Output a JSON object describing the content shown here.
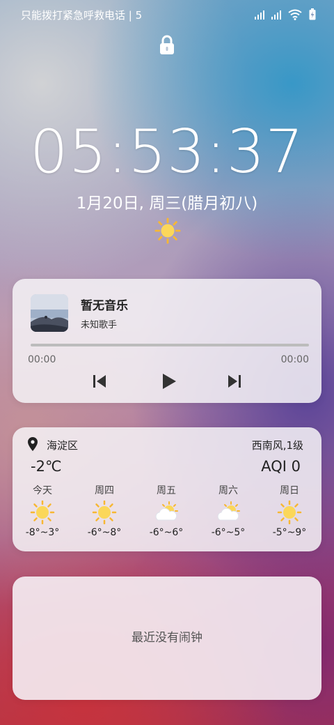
{
  "status_bar": {
    "text": "只能拨打紧急呼救电话 | 5",
    "icons": [
      "signal-icon",
      "signal-icon",
      "wifi-icon",
      "battery-charging-icon"
    ]
  },
  "lock_icon": "lock-icon",
  "clock": {
    "time": "05:53:37",
    "date": "1月20日, 周三(腊月初八)",
    "weather_icon": "sun-icon"
  },
  "music": {
    "title": "暂无音乐",
    "artist": "未知歌手",
    "elapsed": "00:00",
    "duration": "00:00",
    "progress": 0,
    "controls": [
      "previous-icon",
      "play-icon",
      "next-icon"
    ]
  },
  "weather": {
    "location": "海淀区",
    "wind": "西南风,1级",
    "temperature": "-2℃",
    "aqi": "AQI  0",
    "forecast": [
      {
        "day": "今天",
        "icon": "sun-icon",
        "range": "-8°~3°"
      },
      {
        "day": "周四",
        "icon": "sun-icon",
        "range": "-6°~8°"
      },
      {
        "day": "周五",
        "icon": "partly-cloudy-icon",
        "range": "-6°~6°"
      },
      {
        "day": "周六",
        "icon": "partly-cloudy-icon",
        "range": "-6°~5°"
      },
      {
        "day": "周日",
        "icon": "sun-icon",
        "range": "-5°~9°"
      }
    ]
  },
  "alarm": {
    "text": "最近没有闹钟"
  },
  "colors": {
    "sun": "#f7b733",
    "card": "#f5f2f6"
  }
}
